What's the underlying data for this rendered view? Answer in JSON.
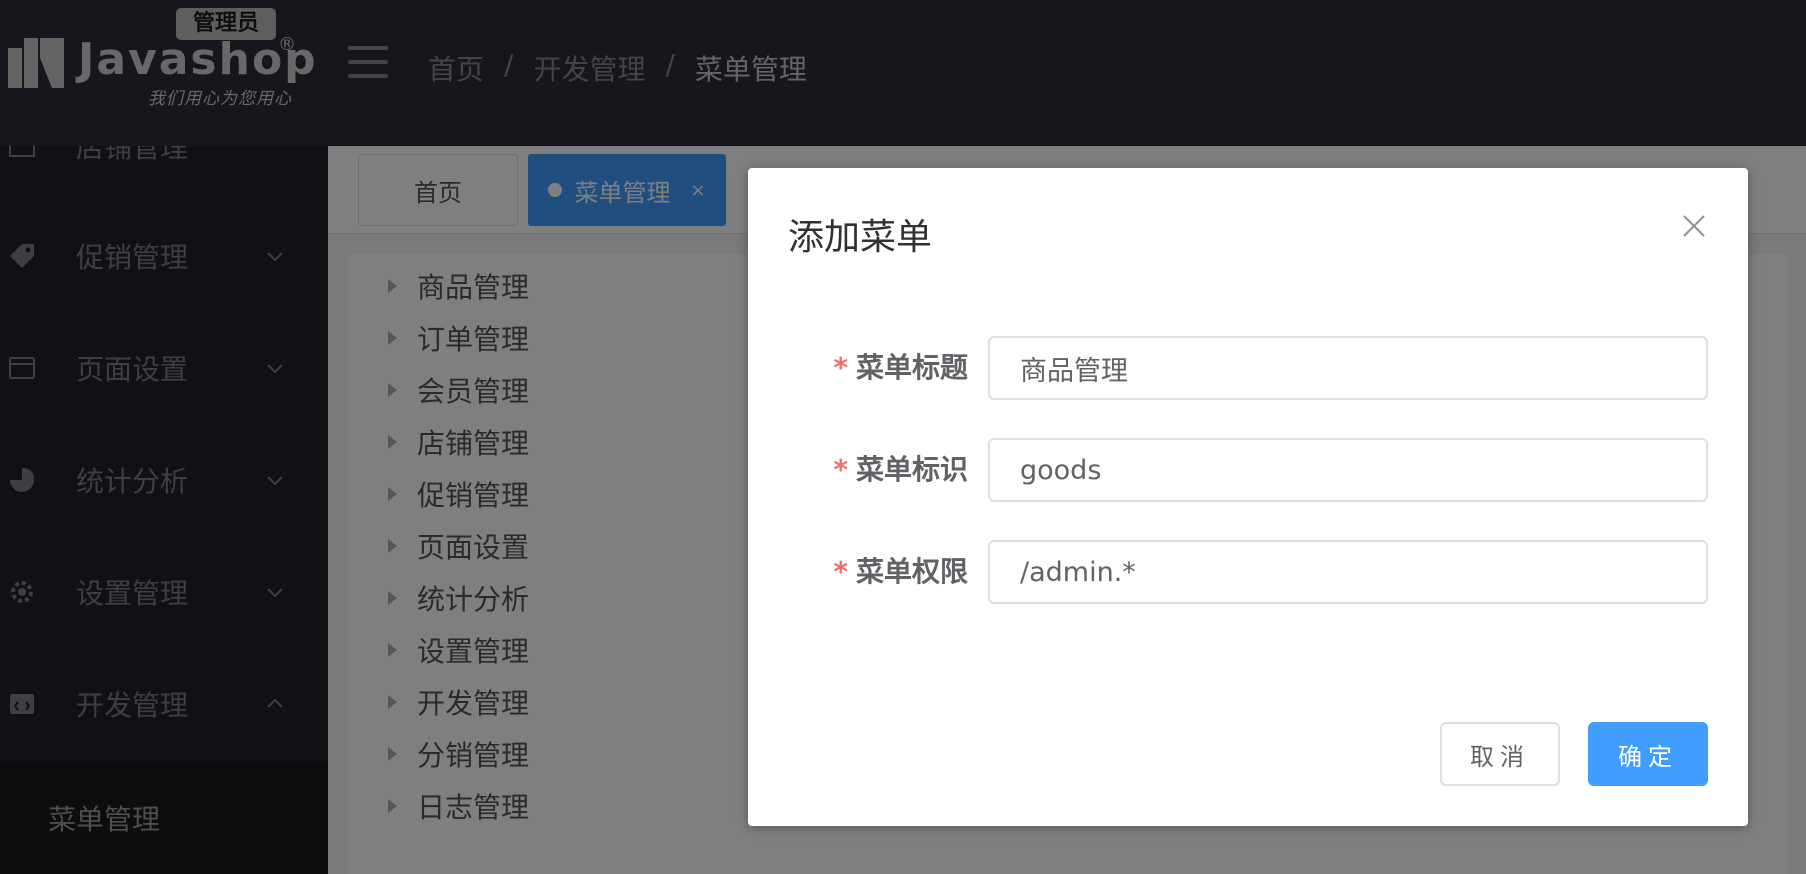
{
  "header": {
    "logo_badge": "管理员",
    "logo_text": "Javashop",
    "logo_reg": "®",
    "logo_slogan": "我们用心为您用心",
    "breadcrumb": [
      "首页",
      "开发管理",
      "菜单管理"
    ],
    "breadcrumb_sep": "/"
  },
  "sidebar": {
    "items": [
      {
        "label": "店铺管理",
        "icon": "store-icon"
      },
      {
        "label": "促销管理",
        "icon": "tag-icon"
      },
      {
        "label": "页面设置",
        "icon": "window-icon"
      },
      {
        "label": "统计分析",
        "icon": "pie-chart-icon"
      },
      {
        "label": "设置管理",
        "icon": "gear-icon"
      },
      {
        "label": "开发管理",
        "icon": "code-window-icon"
      }
    ],
    "submenu_item": "菜单管理"
  },
  "tabs": {
    "home": "首页",
    "active": "菜单管理",
    "close": "×"
  },
  "tree": {
    "items": [
      "商品管理",
      "订单管理",
      "会员管理",
      "店铺管理",
      "促销管理",
      "页面设置",
      "统计分析",
      "设置管理",
      "开发管理",
      "分销管理",
      "日志管理"
    ]
  },
  "dialog": {
    "title": "添加菜单",
    "required_mark": "*",
    "fields": [
      {
        "label": "菜单标题",
        "value": "商品管理"
      },
      {
        "label": "菜单标识",
        "value": "goods"
      },
      {
        "label": "菜单权限",
        "value": "/admin.*"
      }
    ],
    "cancel_label": "取消",
    "confirm_label": "确定"
  },
  "colors": {
    "primary": "#409eff",
    "required": "#f56c6c",
    "header_bg": "#2b2f3a",
    "sidebar_bg": "#1f2229"
  }
}
